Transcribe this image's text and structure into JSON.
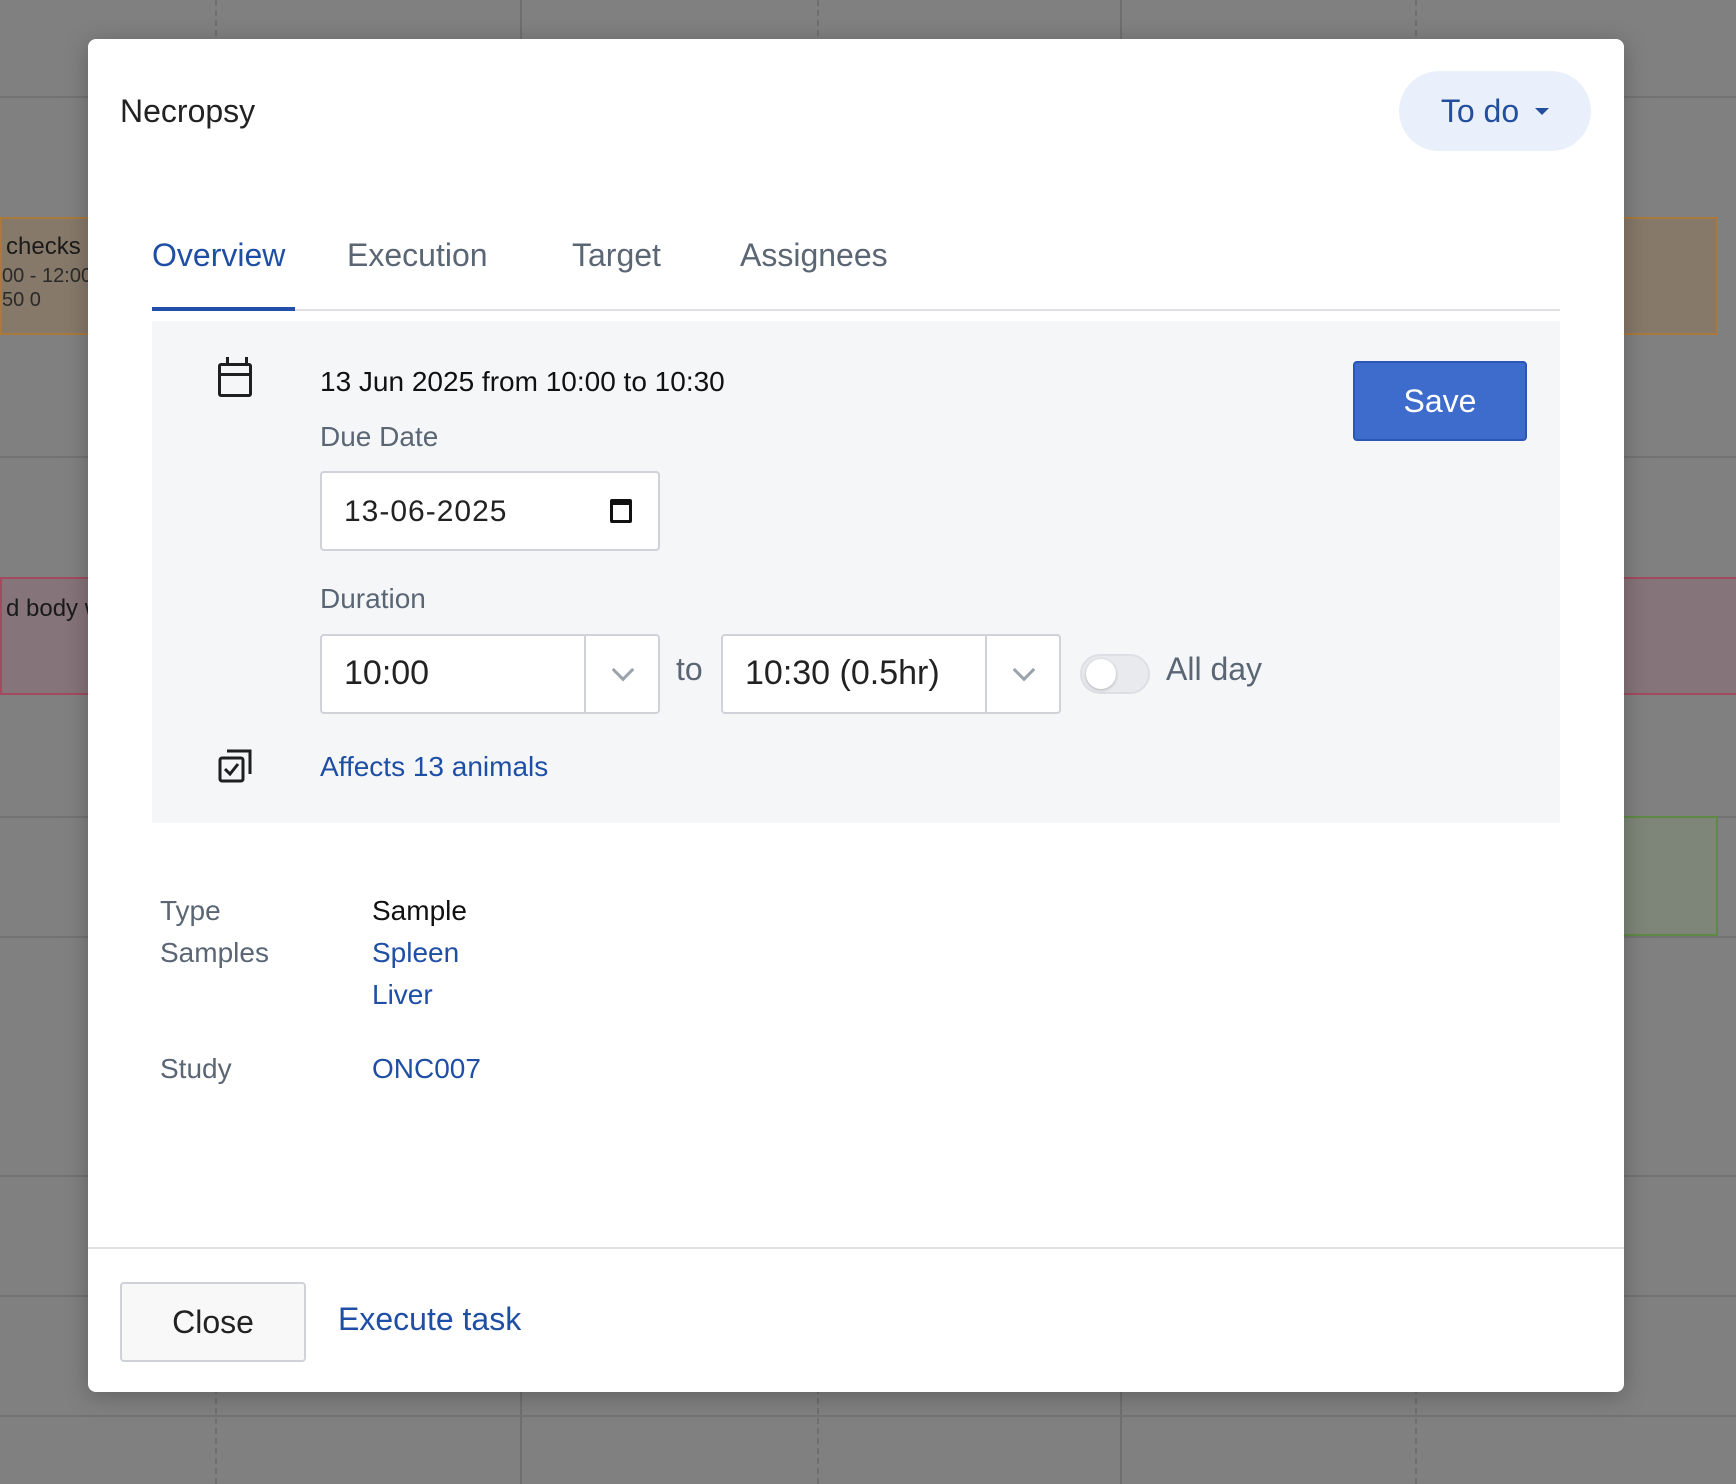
{
  "background": {
    "event_left_1": {
      "title": "checks",
      "time": "00 - 12:00",
      "meta": "50   0"
    },
    "event_left_2": {
      "title": "d body w"
    }
  },
  "modal": {
    "title": "Necropsy",
    "status": "To do",
    "tabs": [
      {
        "label": "Overview",
        "active": true
      },
      {
        "label": "Execution",
        "active": false
      },
      {
        "label": "Target",
        "active": false
      },
      {
        "label": "Assignees",
        "active": false
      }
    ],
    "schedule": {
      "summary": "13 Jun 2025 from 10:00 to 10:30",
      "due_date_label": "Due Date",
      "due_date_value": "13-06-2025",
      "duration_label": "Duration",
      "start_time": "10:00",
      "to_label": "to",
      "end_time": "10:30 (0.5hr)",
      "all_day_label": "All day",
      "all_day_on": false,
      "save_label": "Save",
      "affects_label": "Affects 13 animals"
    },
    "properties": {
      "type_label": "Type",
      "type_value": "Sample",
      "samples_label": "Samples",
      "samples": [
        "Spleen",
        "Liver"
      ],
      "study_label": "Study",
      "study_value": "ONC007"
    },
    "footer": {
      "close_label": "Close",
      "execute_label": "Execute task"
    }
  },
  "colors": {
    "accent": "#3d6ccc",
    "link": "#1f4fa5",
    "status_bg": "#e9f0fb"
  }
}
